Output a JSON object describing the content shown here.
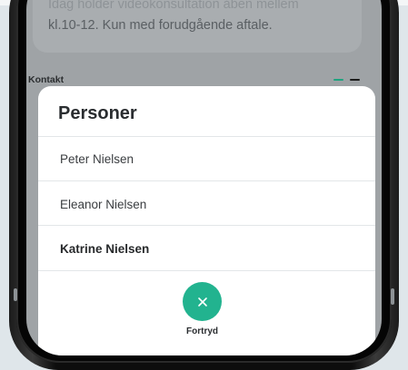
{
  "background": {
    "card_text_top": "Idag holder videokonsultation åben mellem",
    "card_text": "kl.10-12. Kun med forudgående aftale.",
    "section_label": "Kontakt",
    "dash_colors": [
      "#1fa37f",
      "#1b1b1b"
    ]
  },
  "sheet": {
    "title": "Personer",
    "people": [
      "Peter Nielsen",
      "Eleanor Nielsen",
      "Katrine Nielsen"
    ],
    "cancel_label": "Fortryd",
    "cancel_icon": "close-icon",
    "accent_color": "#22b38f"
  }
}
